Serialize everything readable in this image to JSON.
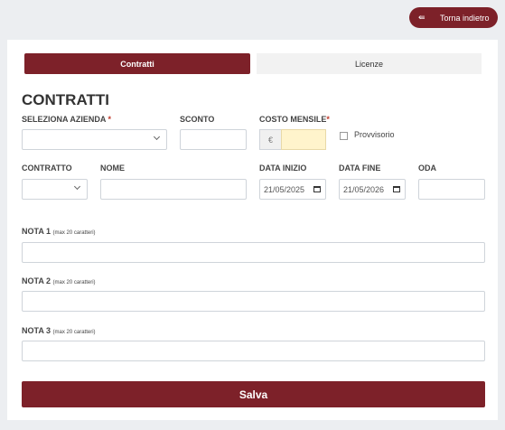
{
  "header": {
    "back_label": "Torna indietro"
  },
  "tabs": {
    "active": "Contratti",
    "inactive": "Licenze"
  },
  "form": {
    "title": "CONTRATTI",
    "azienda_label": "SELEZIONA AZIENDA",
    "required_mark": "*",
    "sconto_label": "SCONTO",
    "costo_label": "COSTO MENSILE",
    "currency": "€",
    "provvisorio_label": "Provvisorio",
    "contratto_label": "CONTRATTO",
    "nome_label": "NOME",
    "data_inizio_label": "DATA INIZIO",
    "data_inizio_value": "21/05/2025",
    "data_fine_label": "DATA FINE",
    "data_fine_value": "21/05/2026",
    "oda_label": "ODA",
    "nota1_label": "NOTA 1",
    "nota2_label": "NOTA 2",
    "nota3_label": "NOTA 3",
    "nota_hint": "(max 20 caratteri)",
    "save_label": "Salva"
  }
}
